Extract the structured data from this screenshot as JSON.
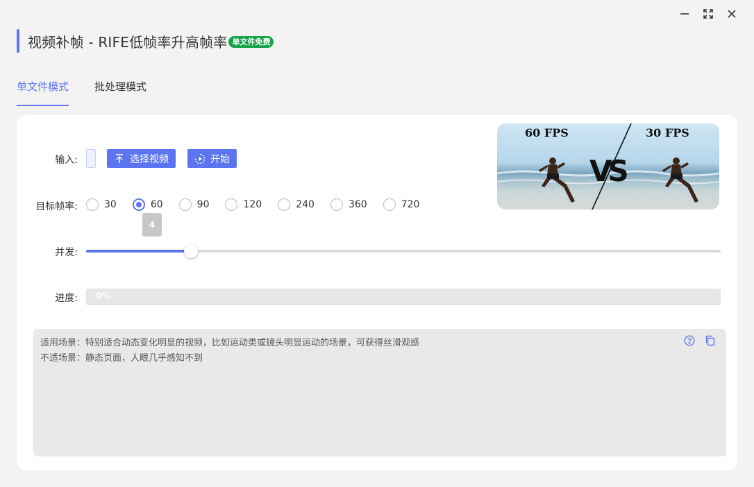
{
  "window": {
    "minimize_icon": "minimize-icon",
    "maximize_icon": "maximize-icon",
    "close_icon": "close-icon"
  },
  "header": {
    "title": "视频补帧 - RIFE低帧率升高帧率",
    "badge": "单文件免费",
    "badge_color": "#17a34a"
  },
  "tabs": [
    {
      "label": "单文件模式",
      "active": true
    },
    {
      "label": "批处理模式",
      "active": false
    }
  ],
  "form": {
    "input_label": "输入:",
    "select_video_label": "选择视频",
    "start_label": "开始",
    "fps_label": "目标帧率:",
    "fps_options": [
      "30",
      "60",
      "90",
      "120",
      "240",
      "360",
      "720"
    ],
    "fps_selected": "60",
    "concurrency_label": "并发:",
    "concurrency_value": "4",
    "concurrency_fill_fraction": 0.165,
    "progress_label": "进度:",
    "progress_text": "0%",
    "progress_value": 0
  },
  "info": {
    "line1": "适用场景：特别适合动态变化明显的视频，比如运动类或镜头明显运动的场景，可获得丝滑观感",
    "line2": "不适场景：静态页面，人眼几乎感知不到",
    "help_icon": "help-circle-icon",
    "copy_icon": "copy-icon"
  },
  "preview": {
    "left_fps": "60 FPS",
    "right_fps": "30 FPS",
    "vs": "VS"
  },
  "colors": {
    "accent": "#5b75f0",
    "badge": "#17a34a"
  }
}
